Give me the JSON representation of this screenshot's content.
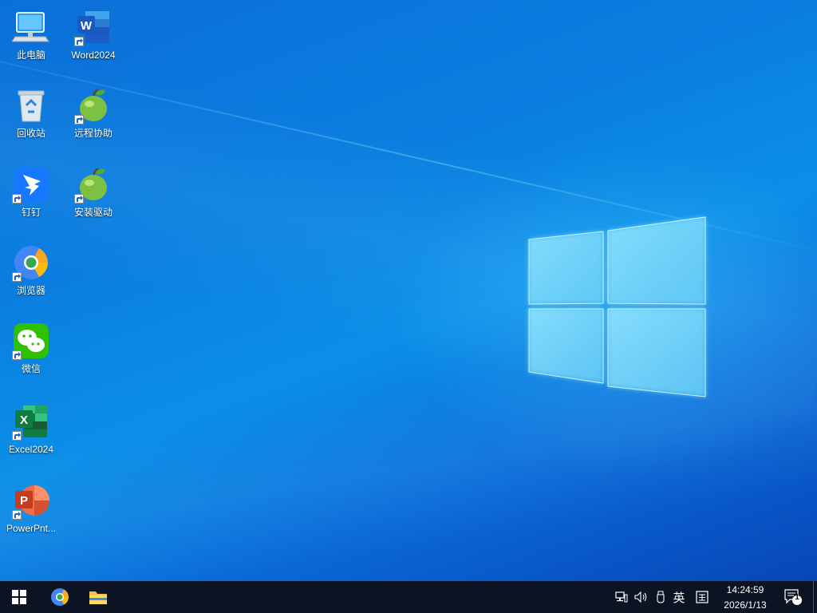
{
  "desktop": {
    "icons": [
      {
        "label": "此电脑",
        "icon": "computer-icon"
      },
      {
        "label": "Word2024",
        "icon": "word-icon"
      },
      {
        "label": "回收站",
        "icon": "recycle-bin-icon"
      },
      {
        "label": "远程协助",
        "icon": "apple-icon"
      },
      {
        "label": "钉钉",
        "icon": "dingtalk-icon"
      },
      {
        "label": "安装驱动",
        "icon": "apple-icon"
      },
      {
        "label": "浏览器",
        "icon": "browser-icon"
      },
      {
        "label": "微信",
        "icon": "wechat-icon"
      },
      {
        "label": "Excel2024",
        "icon": "excel-icon"
      },
      {
        "label": "PowerPnt...",
        "icon": "powerpoint-icon"
      }
    ]
  },
  "taskbar": {
    "pinned": [
      {
        "name": "start-button",
        "icon": "windows-icon"
      },
      {
        "name": "browser",
        "icon": "browser-icon"
      },
      {
        "name": "file-explorer",
        "icon": "folder-icon"
      }
    ],
    "tray": {
      "ime_label": "英",
      "time": "14:24:59",
      "date": "2026/1/13",
      "notification_count": "1"
    }
  },
  "colors": {
    "taskbar": "#0c1424",
    "accent": "#0a7fe0",
    "label_text": "#ffffff"
  }
}
